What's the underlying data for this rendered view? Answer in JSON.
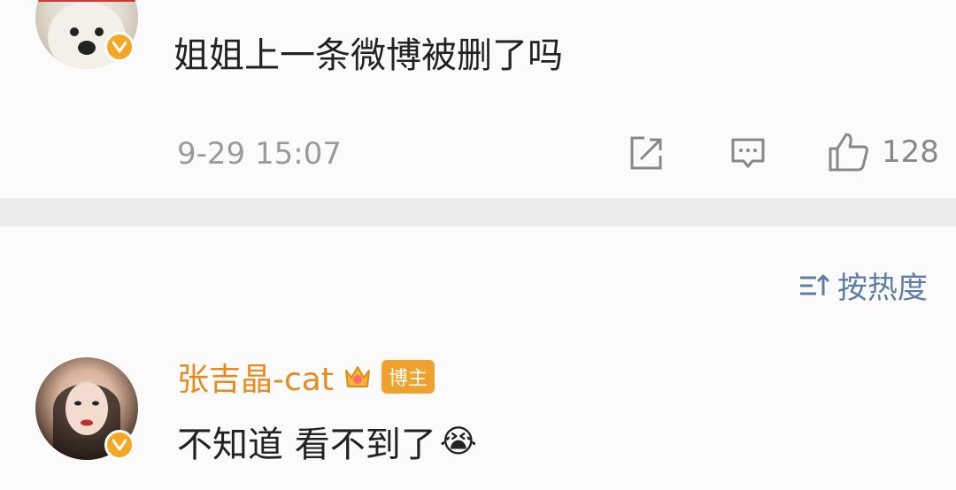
{
  "comment_top": {
    "text": "姐姐上一条微博被删了吗",
    "time": "9-29 15:07",
    "like_count": "128",
    "icons": [
      "share-icon",
      "comment-icon",
      "like-icon"
    ]
  },
  "sort": {
    "label": "按热度",
    "icon": "sort-icon"
  },
  "comment_second": {
    "username": "张吉晶-cat",
    "tag": "博主",
    "text": "不知道 看不到了",
    "emoji": "😭"
  },
  "colors": {
    "username": "#e88a1e",
    "accent_blue": "#5d7da8",
    "divider": "#ececec",
    "verified": "#f5a623"
  }
}
